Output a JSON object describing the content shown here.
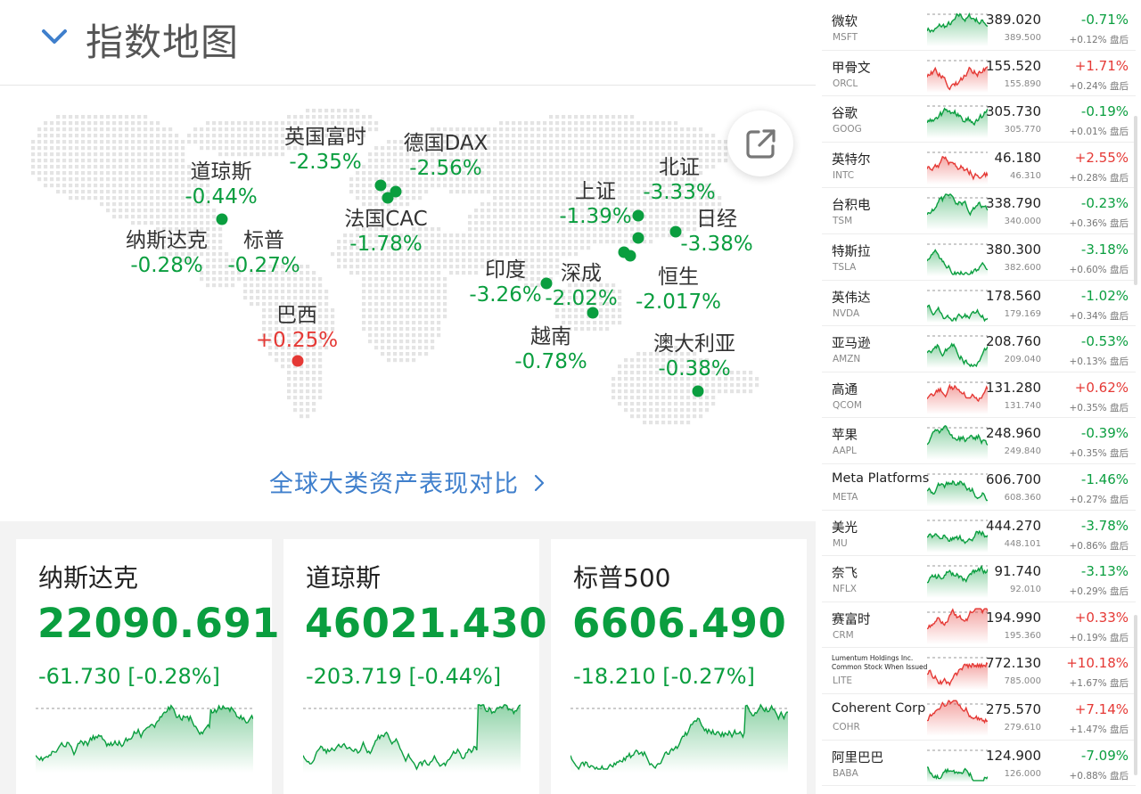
{
  "header": {
    "title": "指数地图",
    "toggle_icon": "chevron-down-icon"
  },
  "map": {
    "compare_link": "全球大类资产表现对比",
    "compare_icon": "chevron-right-icon",
    "share_icon": "external-link-icon",
    "markers": [
      {
        "name": "英国富时",
        "change": "-2.35%",
        "dir": "down"
      },
      {
        "name": "德国DAX",
        "change": "-2.56%",
        "dir": "down"
      },
      {
        "name": "道琼斯",
        "change": "-0.44%",
        "dir": "down"
      },
      {
        "name": "北证",
        "change": "-3.33%",
        "dir": "down"
      },
      {
        "name": "上证",
        "change": "-1.39%",
        "dir": "down"
      },
      {
        "name": "法国CAC",
        "change": "-1.78%",
        "dir": "down"
      },
      {
        "name": "日经",
        "change": "-3.38%",
        "dir": "down"
      },
      {
        "name": "纳斯达克",
        "change": "-0.28%",
        "dir": "down"
      },
      {
        "name": "标普",
        "change": "-0.27%",
        "dir": "down"
      },
      {
        "name": "印度",
        "change": "-3.26%",
        "dir": "down"
      },
      {
        "name": "深成",
        "change": "-2.02%",
        "dir": "down"
      },
      {
        "name": "恒生",
        "change": "-2.017%",
        "dir": "down"
      },
      {
        "name": "巴西",
        "change": "+0.25%",
        "dir": "up"
      },
      {
        "name": "越南",
        "change": "-0.78%",
        "dir": "down"
      },
      {
        "name": "澳大利亚",
        "change": "-0.38%",
        "dir": "down"
      }
    ]
  },
  "cards": [
    {
      "name": "纳斯达克",
      "value": "22090.691",
      "change": "-61.730 [-0.28%]"
    },
    {
      "name": "道琼斯",
      "value": "46021.430",
      "change": "-203.719 [-0.44%]"
    },
    {
      "name": "标普500",
      "value": "6606.490",
      "change": "-18.210 [-0.27%]"
    }
  ],
  "stocks": [
    {
      "name": "微软",
      "ticker": "MSFT",
      "price": "389.020",
      "prev": "389.500",
      "change": "-0.71%",
      "after": "+0.12% 盘后",
      "dir": "down"
    },
    {
      "name": "甲骨文",
      "ticker": "ORCL",
      "price": "155.520",
      "prev": "155.890",
      "change": "+1.71%",
      "after": "+0.24% 盘后",
      "dir": "up"
    },
    {
      "name": "谷歌",
      "ticker": "GOOG",
      "price": "305.730",
      "prev": "305.770",
      "change": "-0.19%",
      "after": "+0.01% 盘后",
      "dir": "down"
    },
    {
      "name": "英特尔",
      "ticker": "INTC",
      "price": "46.180",
      "prev": "46.310",
      "change": "+2.55%",
      "after": "+0.28% 盘后",
      "dir": "up"
    },
    {
      "name": "台积电",
      "ticker": "TSM",
      "price": "338.790",
      "prev": "340.000",
      "change": "-0.23%",
      "after": "+0.36% 盘后",
      "dir": "down"
    },
    {
      "name": "特斯拉",
      "ticker": "TSLA",
      "price": "380.300",
      "prev": "382.600",
      "change": "-3.18%",
      "after": "+0.60% 盘后",
      "dir": "down"
    },
    {
      "name": "英伟达",
      "ticker": "NVDA",
      "price": "178.560",
      "prev": "179.169",
      "change": "-1.02%",
      "after": "+0.34% 盘后",
      "dir": "down"
    },
    {
      "name": "亚马逊",
      "ticker": "AMZN",
      "price": "208.760",
      "prev": "209.040",
      "change": "-0.53%",
      "after": "+0.13% 盘后",
      "dir": "down"
    },
    {
      "name": "高通",
      "ticker": "QCOM",
      "price": "131.280",
      "prev": "131.740",
      "change": "+0.62%",
      "after": "+0.35% 盘后",
      "dir": "up"
    },
    {
      "name": "苹果",
      "ticker": "AAPL",
      "price": "248.960",
      "prev": "249.840",
      "change": "-0.39%",
      "after": "+0.35% 盘后",
      "dir": "down"
    },
    {
      "name": "Meta Platforms",
      "ticker": "META",
      "price": "606.700",
      "prev": "608.360",
      "change": "-1.46%",
      "after": "+0.27% 盘后",
      "dir": "down"
    },
    {
      "name": "美光",
      "ticker": "MU",
      "price": "444.270",
      "prev": "448.101",
      "change": "-3.78%",
      "after": "+0.86% 盘后",
      "dir": "down"
    },
    {
      "name": "奈飞",
      "ticker": "NFLX",
      "price": "91.740",
      "prev": "92.010",
      "change": "-3.13%",
      "after": "+0.29% 盘后",
      "dir": "down"
    },
    {
      "name": "赛富时",
      "ticker": "CRM",
      "price": "194.990",
      "prev": "195.360",
      "change": "+0.33%",
      "after": "+0.19% 盘后",
      "dir": "up"
    },
    {
      "name": "Lumentum Holdings Inc. Common Stock When Issued",
      "ticker": "LITE",
      "price": "772.130",
      "prev": "785.000",
      "change": "+10.18%",
      "after": "+1.67% 盘后",
      "dir": "up",
      "small": true
    },
    {
      "name": "Coherent Corp",
      "ticker": "COHR",
      "price": "275.570",
      "prev": "279.610",
      "change": "+7.14%",
      "after": "+1.47% 盘后",
      "dir": "up"
    },
    {
      "name": "阿里巴巴",
      "ticker": "BABA",
      "price": "124.900",
      "prev": "126.000",
      "change": "-7.09%",
      "after": "+0.88% 盘后",
      "dir": "down"
    }
  ],
  "colors": {
    "up": "#e53935",
    "down": "#0a9e3f",
    "link": "#3f7fcc"
  }
}
